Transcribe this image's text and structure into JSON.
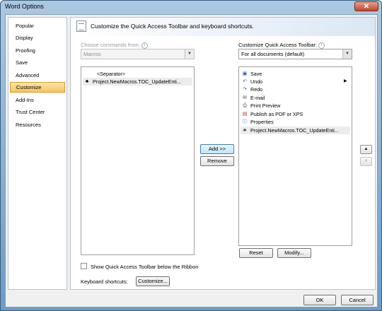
{
  "window": {
    "title": "Word Options",
    "close_glyph": "✕"
  },
  "nav": {
    "items": [
      {
        "label": "Popular",
        "selected": false
      },
      {
        "label": "Display",
        "selected": false
      },
      {
        "label": "Proofing",
        "selected": false
      },
      {
        "label": "Save",
        "selected": false
      },
      {
        "label": "Advanced",
        "selected": false
      },
      {
        "label": "Customize",
        "selected": true
      },
      {
        "label": "Add-Ins",
        "selected": false
      },
      {
        "label": "Trust Center",
        "selected": false
      },
      {
        "label": "Resources",
        "selected": false
      }
    ]
  },
  "header": {
    "text": "Customize the Quick Access Toolbar and keyboard shortcuts."
  },
  "choose": {
    "label": "Choose commands from:",
    "info": "i",
    "value": "Macros"
  },
  "commands_list": [
    {
      "label": "<Separator>",
      "icon": ""
    },
    {
      "label": "Project.NewMacros.TOC_UpdateEnti...",
      "icon": "macro-icon",
      "glyph": "♣"
    }
  ],
  "customize_qat": {
    "label": "Customize Quick Access Toolbar:",
    "info": "i",
    "value": "For all documents (default)"
  },
  "toolbar_list": [
    {
      "label": "Save",
      "icon": "save-icon",
      "glyph": "▣",
      "color": "#2b5aa8"
    },
    {
      "label": "Undo",
      "icon": "undo-icon",
      "glyph": "↶",
      "color": "#2b5aa8"
    },
    {
      "label": "Redo",
      "icon": "redo-icon",
      "glyph": "↷",
      "color": "#2b5aa8"
    },
    {
      "label": "E-mail",
      "icon": "email-icon",
      "glyph": "✉",
      "color": "#4a4a4a"
    },
    {
      "label": "Print Preview",
      "icon": "print-preview-icon",
      "glyph": "⎙",
      "color": "#4a4a4a"
    },
    {
      "label": "Publish as PDF or XPS",
      "icon": "publish-pdf-icon",
      "glyph": "▤",
      "color": "#b03a2e"
    },
    {
      "label": "Properties",
      "icon": "properties-icon",
      "glyph": "ⓘ",
      "color": "#2b5aa8"
    },
    {
      "label": "Project.NewMacros.TOC_UpdateEnti...",
      "icon": "macro-icon",
      "glyph": "♣",
      "color": "#4a4a4a"
    }
  ],
  "buttons": {
    "add": "Add >>",
    "remove": "Remove",
    "reset": "Reset",
    "modify": "Modify...",
    "customize": "Customize...",
    "ok": "OK",
    "cancel": "Cancel",
    "move_up": "▲",
    "move_down": "▼"
  },
  "show_below_ribbon": {
    "label": "Show Quick Access Toolbar below the Ribbon",
    "checked": false
  },
  "keyboard": {
    "label": "Keyboard shortcuts:"
  }
}
